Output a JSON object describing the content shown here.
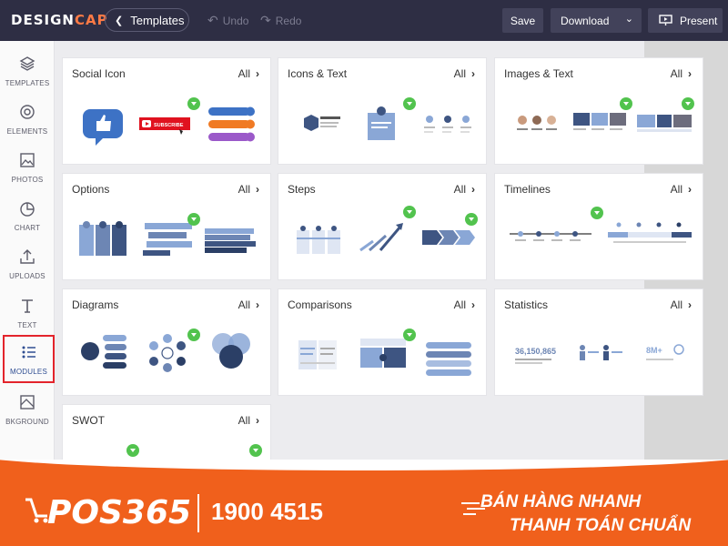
{
  "app": {
    "logo_main": "DESIGN",
    "logo_accent": "CAP"
  },
  "toolbar": {
    "templates_label": "Templates",
    "undo_label": "Undo",
    "redo_label": "Redo",
    "save_label": "Save",
    "download_label": "Download",
    "present_label": "Present"
  },
  "sidebar": {
    "items": [
      {
        "label": "TEMPLATES",
        "icon": "layers-icon"
      },
      {
        "label": "ELEMENTS",
        "icon": "elements-icon"
      },
      {
        "label": "PHOTOS",
        "icon": "photo-icon"
      },
      {
        "label": "CHART",
        "icon": "pie-chart-icon"
      },
      {
        "label": "UPLOADS",
        "icon": "upload-icon"
      },
      {
        "label": "TEXT",
        "icon": "text-icon"
      },
      {
        "label": "MODULES",
        "icon": "list-icon",
        "active": true
      },
      {
        "label": "BKGROUND",
        "icon": "background-icon"
      }
    ]
  },
  "modules": {
    "all_label": "All",
    "cards": [
      {
        "title": "Social Icon"
      },
      {
        "title": "Icons & Text"
      },
      {
        "title": "Images & Text"
      },
      {
        "title": "Options"
      },
      {
        "title": "Steps"
      },
      {
        "title": "Timelines"
      },
      {
        "title": "Diagrams"
      },
      {
        "title": "Comparisons"
      },
      {
        "title": "Statistics"
      },
      {
        "title": "SWOT"
      }
    ]
  },
  "thumb_text": {
    "subscribe": "SUBSCRIBE",
    "stat1": "36,150,865",
    "stat2": "8M+"
  },
  "banner": {
    "brand": "POS365",
    "phone": "1900 4515",
    "slogan_line1": "BÁN HÀNG NHANH",
    "slogan_line2": "THANH TOÁN CHUẨN"
  },
  "colors": {
    "topbar": "#2e2e44",
    "accent_orange": "#f0601c",
    "premium_green": "#52c34e",
    "active_border": "#e3242b"
  }
}
